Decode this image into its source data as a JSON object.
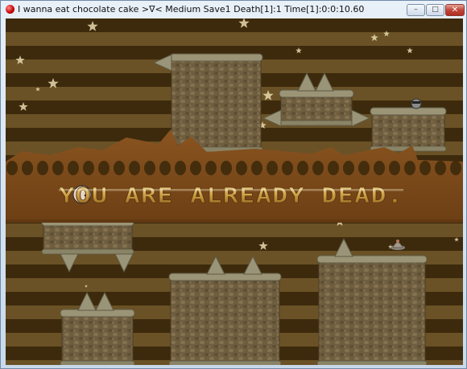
{
  "window": {
    "title": "I wanna eat chocolate cake >∇< Medium  Save1 Death[1]:1 Time[1]:0:0:10.60",
    "minimize_glyph": "–",
    "maximize_glyph": "□",
    "close_glyph": "✕"
  },
  "game": {
    "overlay_message": "YOU ARE ALREADY DEAD."
  },
  "colors": {
    "stripe_dark": "#3d2a0c",
    "stripe_light": "#6a5226",
    "banner": "#7a4a1a",
    "block_fill": "#6f5d3f",
    "block_top": "#9b9476",
    "spike": "#9a9478",
    "star": "#e8d9b0",
    "text_gold": "#e8c36a"
  }
}
